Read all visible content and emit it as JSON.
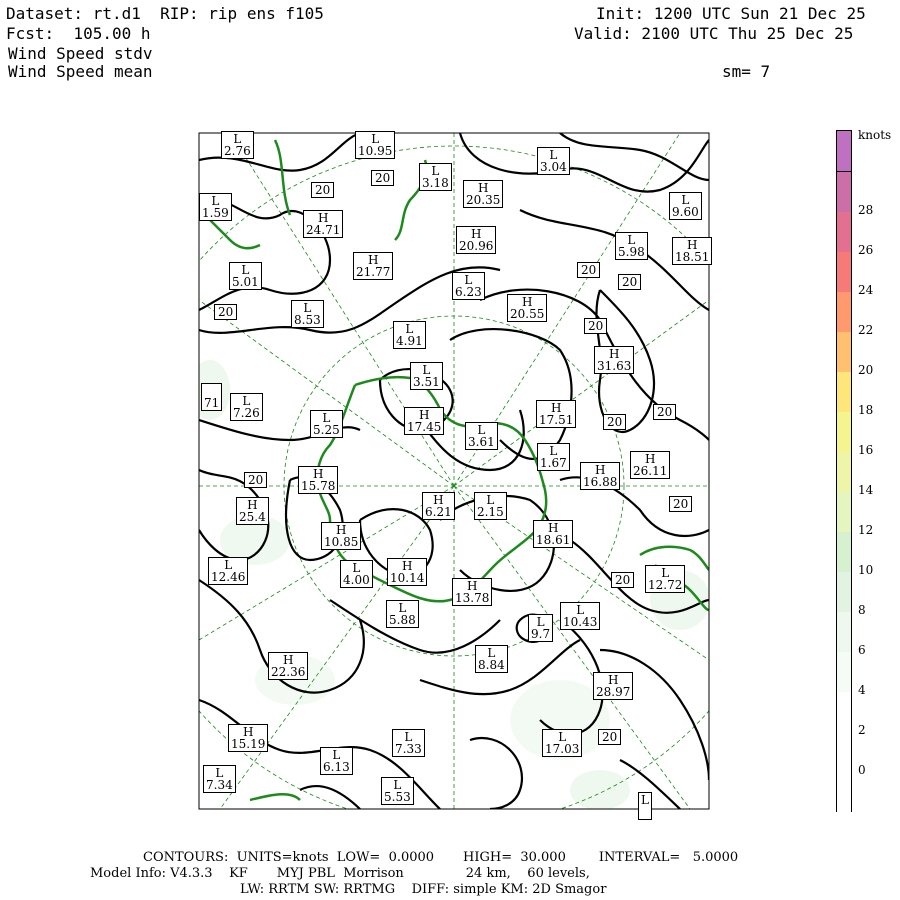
{
  "header": {
    "dataset_line": "Dataset: rt.d1  RIP: rip ens f105",
    "fcst_line": "Fcst:  105.00 h",
    "field1": "Wind Speed stdv",
    "field2": "Wind Speed mean",
    "init_line": "Init: 1200 UTC Sun 21 Dec 25",
    "valid_line": "Valid: 2100 UTC Thu 25 Dec 25",
    "smooth": "sm= 7"
  },
  "colorbar": {
    "units": "knots",
    "ticks": [
      "0",
      "2",
      "4",
      "6",
      "8",
      "10",
      "12",
      "14",
      "16",
      "18",
      "20",
      "22",
      "24",
      "26",
      "28"
    ],
    "colors": [
      "#ffffff",
      "#ffffff",
      "#ffffff",
      "#f5fbf5",
      "#eef8ee",
      "#e2f3e2",
      "#d6f0d0",
      "#e4f5c0",
      "#eef5a8",
      "#f5f590",
      "#ffe67a",
      "#ffc070",
      "#ff9a6e",
      "#f57a78",
      "#e27090",
      "#cc6fa8",
      "#c070c0"
    ]
  },
  "map_labels": [
    {
      "t": "L",
      "v": "2.76"
    },
    {
      "t": "L",
      "v": "10.95"
    },
    {
      "t": "L",
      "v": "3.04"
    },
    {
      "t": "L",
      "v": "3.18"
    },
    {
      "t": "H",
      "v": "20.35"
    },
    {
      "t": "L",
      "v": "9.60"
    },
    {
      "t": "L",
      "v": "1.59"
    },
    {
      "t": "H",
      "v": "24.71"
    },
    {
      "t": "H",
      "v": "20.96"
    },
    {
      "t": "L",
      "v": "5.98"
    },
    {
      "t": "H",
      "v": "18.51"
    },
    {
      "t": "L",
      "v": "5.01"
    },
    {
      "t": "H",
      "v": "21.77"
    },
    {
      "t": "L",
      "v": "6.23"
    },
    {
      "t": "L",
      "v": "8.53"
    },
    {
      "t": "H",
      "v": "20.55"
    },
    {
      "t": "L",
      "v": "4.91"
    },
    {
      "t": "H",
      "v": "31.63"
    },
    {
      "t": "L",
      "v": "3.51"
    },
    {
      "t": "L",
      "v": "7.26"
    },
    {
      "t": "",
      "v": "71"
    },
    {
      "t": "H",
      "v": "17.51"
    },
    {
      "t": "L",
      "v": "5.25"
    },
    {
      "t": "H",
      "v": "17.45"
    },
    {
      "t": "L",
      "v": "3.61"
    },
    {
      "t": "L",
      "v": "1.67"
    },
    {
      "t": "H",
      "v": "26.11"
    },
    {
      "t": "H",
      "v": "15.78"
    },
    {
      "t": "H",
      "v": "16.88"
    },
    {
      "t": "H",
      "v": "25.4"
    },
    {
      "t": "H",
      "v": "6.21"
    },
    {
      "t": "L",
      "v": "2.15"
    },
    {
      "t": "H",
      "v": "10.85"
    },
    {
      "t": "H",
      "v": "18.61"
    },
    {
      "t": "L",
      "v": "12.46"
    },
    {
      "t": "L",
      "v": "4.00"
    },
    {
      "t": "H",
      "v": "10.14"
    },
    {
      "t": "H",
      "v": "13.78"
    },
    {
      "t": "L",
      "v": "12.72"
    },
    {
      "t": "L",
      "v": "5.88"
    },
    {
      "t": "L",
      "v": "9.7"
    },
    {
      "t": "L",
      "v": "10.43"
    },
    {
      "t": "H",
      "v": "22.36"
    },
    {
      "t": "L",
      "v": "8.84"
    },
    {
      "t": "H",
      "v": "28.97"
    },
    {
      "t": "H",
      "v": "15.19"
    },
    {
      "t": "L",
      "v": "7.33"
    },
    {
      "t": "L",
      "v": "17.03"
    },
    {
      "t": "L",
      "v": "6.13"
    },
    {
      "t": "L",
      "v": "7.34"
    },
    {
      "t": "L",
      "v": "5.53"
    },
    {
      "t": "L",
      "v": ""
    }
  ],
  "contour_value_label": "20",
  "footer": {
    "contours_line": "CONTOURS:  UNITS=knots  LOW=  0.0000       HIGH=  30.000        INTERVAL=   5.0000",
    "model_line": "Model Info: V4.3.3    KF       MYJ PBL  Morrison               24 km,    60 levels,",
    "physics_line": "LW: RRTM SW: RRTMG    DIFF: simple KM: 2D Smagor"
  }
}
